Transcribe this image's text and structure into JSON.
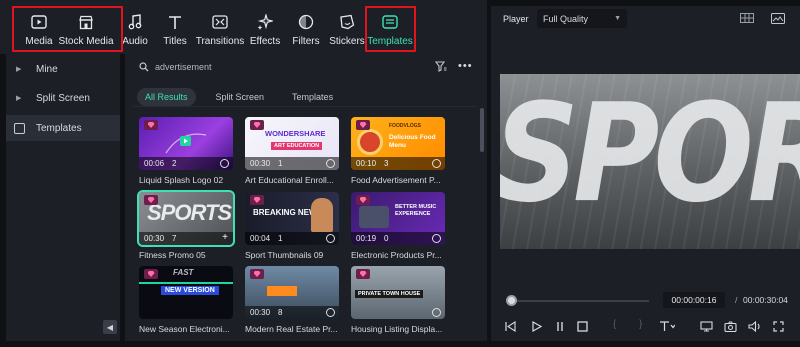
{
  "toolbar": {
    "items": [
      {
        "label": "Media",
        "icon": "media-icon"
      },
      {
        "label": "Stock Media",
        "icon": "stock-media-icon"
      },
      {
        "label": "Audio",
        "icon": "music-note-icon"
      },
      {
        "label": "Titles",
        "icon": "text-t-icon"
      },
      {
        "label": "Transitions",
        "icon": "transitions-icon"
      },
      {
        "label": "Effects",
        "icon": "sparkle-icon"
      },
      {
        "label": "Filters",
        "icon": "filter-icon"
      },
      {
        "label": "Stickers",
        "icon": "sticker-icon"
      },
      {
        "label": "Templates",
        "icon": "templates-icon"
      }
    ],
    "active_item": "Templates",
    "accent_color": "#3fe0b5",
    "highlight_color": "#e0141e"
  },
  "sidebar": {
    "items": [
      {
        "label": "Mine"
      },
      {
        "label": "Split Screen"
      },
      {
        "label": "Templates"
      }
    ]
  },
  "search": {
    "value": "advertisement"
  },
  "chips": [
    {
      "label": "All Results"
    },
    {
      "label": "Split Screen"
    },
    {
      "label": "Templates"
    }
  ],
  "cards": [
    {
      "title": "Liquid Splash Logo 02",
      "duration": "00:06",
      "count": "2"
    },
    {
      "title": "Art Educational Enroll...",
      "duration": "00:30",
      "count": "1",
      "text1": "WONDERSHARE",
      "text2": "ART EDUCATION"
    },
    {
      "title": "Food Advertisement P...",
      "duration": "00:10",
      "count": "3",
      "text1": "FOODVLOGS",
      "text2": "Delicious Food Menu"
    },
    {
      "title": "Fitness Promo 05",
      "duration": "00:30",
      "count": "7",
      "text1": "SPORTS"
    },
    {
      "title": "Sport Thumbnails 09",
      "duration": "00:04",
      "count": "1",
      "text1": "BREAKING NEWS!"
    },
    {
      "title": "Electronic Products Pr...",
      "duration": "00:19",
      "count": "0",
      "text1": "BETTER MUSIC EXPERIENCE"
    },
    {
      "title": "New Season Electroni...",
      "text1": "NEW VERSION",
      "text2": "FAST"
    },
    {
      "title": "Modern Real Estate Pr...",
      "duration": "00:30",
      "count": "8"
    },
    {
      "title": "Housing Listing Displa...",
      "text1": "PRIVATE TOWN HOUSE"
    }
  ],
  "player": {
    "label": "Player",
    "quality": "Full Quality",
    "preview_text": "SPORTS",
    "current_time": "00:00:00:16",
    "separator": "/",
    "total_time": "00:00:30:04",
    "progress_fraction": 0.02
  }
}
